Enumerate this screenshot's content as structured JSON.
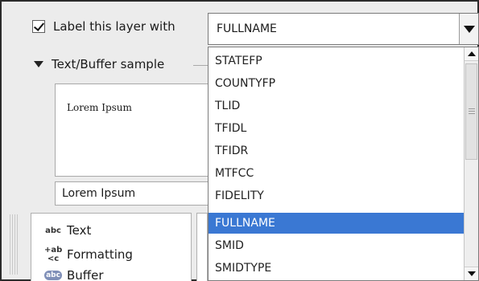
{
  "label_checkbox": {
    "label": "Label this layer with",
    "checked": true
  },
  "field_combo": {
    "value": "FULLNAME"
  },
  "section": {
    "title": "Text/Buffer sample"
  },
  "sample": {
    "preview_text": "Lorem Ipsum",
    "input_value": "Lorem Ipsum"
  },
  "nav": {
    "items": [
      {
        "icon": "abc",
        "label": "Text"
      },
      {
        "icon": "+ab <c",
        "label": "Formatting"
      },
      {
        "icon": "abc",
        "label": "Buffer"
      }
    ]
  },
  "dropdown": {
    "options": [
      "STATEFP",
      "COUNTYFP",
      "TLID",
      "TFIDL",
      "TFIDR",
      "MTFCC",
      "FIDELITY",
      "FULLNAME",
      "SMID",
      "SMIDTYPE"
    ],
    "selected": "FULLNAME"
  },
  "colors": {
    "selection": "#3a78d3"
  }
}
